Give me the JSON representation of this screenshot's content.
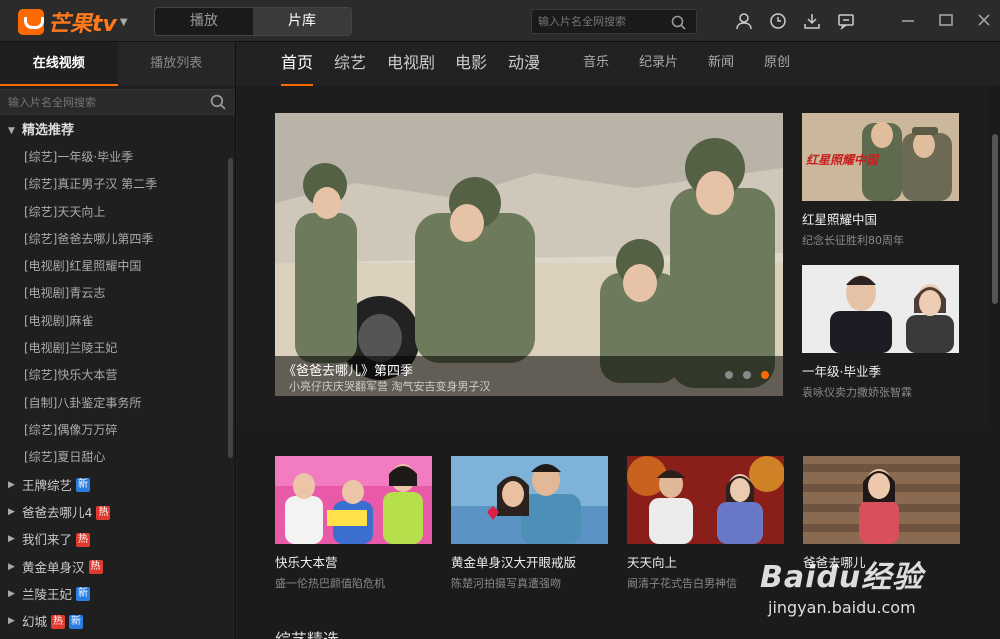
{
  "app": {
    "logo_text": "芒果tv",
    "modes": [
      "播放",
      "片库"
    ],
    "active_mode": 1,
    "search_placeholder": "输入片名全网搜索"
  },
  "left": {
    "tabs": [
      "在线视频",
      "播放列表"
    ],
    "search_placeholder": "输入片名全网搜索",
    "group_title": "精选推荐",
    "items": [
      "[综艺]一年级·毕业季",
      "[综艺]真正男子汉 第二季",
      "[综艺]天天向上",
      "[综艺]爸爸去哪儿第四季",
      "[电视剧]红星照耀中国",
      "[电视剧]青云志",
      "[电视剧]麻雀",
      "[电视剧]兰陵王妃",
      "[综艺]快乐大本营",
      "[自制]八卦鉴定事务所",
      "[综艺]偶像万万碎",
      "[综艺]夏日甜心"
    ],
    "categories": [
      {
        "label": "王牌综艺",
        "badges": [
          "新"
        ]
      },
      {
        "label": "爸爸去哪儿4",
        "badges": [
          "热"
        ]
      },
      {
        "label": "我们来了",
        "badges": [
          "热"
        ]
      },
      {
        "label": "黄金单身汉",
        "badges": [
          "热"
        ]
      },
      {
        "label": "兰陵王妃",
        "badges": [
          "新"
        ]
      },
      {
        "label": "幻城",
        "badges": [
          "热",
          "新"
        ]
      }
    ]
  },
  "nav": {
    "items": [
      "首页",
      "综艺",
      "电视剧",
      "电影",
      "动漫"
    ],
    "small_items": [
      "音乐",
      "纪录片",
      "新闻",
      "原创"
    ]
  },
  "hero": {
    "title": "《爸爸去哪儿》第四季",
    "subtitle": "小亮仔庆庆哭翻军营 淘气安吉变身男子汉",
    "slide_count": 3,
    "active_slide": 3
  },
  "side_cards": [
    {
      "title": "红星照耀中国",
      "subtitle": "纪念长征胜利80周年",
      "poster_text": "红星照耀中国"
    },
    {
      "title": "一年级·毕业季",
      "subtitle": "袁咏仪卖力撒娇张智霖"
    }
  ],
  "row_cards": [
    {
      "title": "快乐大本营",
      "subtitle": "盛一伦热巴颜值陷危机"
    },
    {
      "title": "黄金单身汉大开眼戒版",
      "subtitle": "陈楚河拍摄写真遭强吻"
    },
    {
      "title": "天天向上",
      "subtitle": "阚清子花式告白男神信"
    },
    {
      "title": "爸爸去哪儿",
      "subtitle": ""
    }
  ],
  "section_title": "综艺精选",
  "watermark": {
    "logo": "Baidu经验",
    "url": "jingyan.baidu.com"
  },
  "colors": {
    "accent": "#ff6a00",
    "badge_new": "#2a7de1",
    "badge_hot": "#e03a2f"
  }
}
